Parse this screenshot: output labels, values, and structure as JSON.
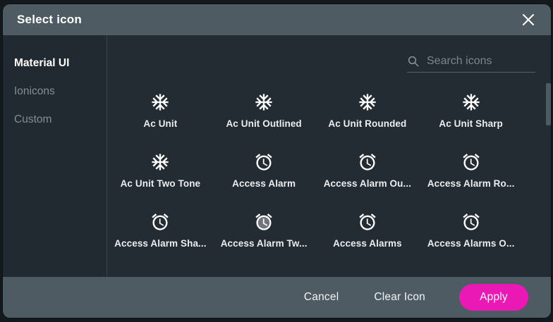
{
  "dialog": {
    "title": "Select icon"
  },
  "sidebar": {
    "items": [
      {
        "label": "Material UI",
        "active": true
      },
      {
        "label": "Ionicons",
        "active": false
      },
      {
        "label": "Custom",
        "active": false
      }
    ]
  },
  "search": {
    "placeholder": "Search icons",
    "icon": "magnifier"
  },
  "icon_grid": {
    "items": [
      {
        "label": "Ac Unit",
        "glyph": "ac-unit"
      },
      {
        "label": "Ac Unit Outlined",
        "glyph": "ac-unit"
      },
      {
        "label": "Ac Unit Rounded",
        "glyph": "ac-unit"
      },
      {
        "label": "Ac Unit Sharp",
        "glyph": "ac-unit"
      },
      {
        "label": "Ac Unit Two Tone",
        "glyph": "ac-unit"
      },
      {
        "label": "Access Alarm",
        "glyph": "access-alarm"
      },
      {
        "label": "Access Alarm Ou...",
        "glyph": "access-alarm"
      },
      {
        "label": "Access Alarm Ro...",
        "glyph": "access-alarm"
      },
      {
        "label": "Access Alarm Sha...",
        "glyph": "access-alarm"
      },
      {
        "label": "Access Alarm Tw...",
        "glyph": "access-alarm-two-tone"
      },
      {
        "label": "Access Alarms",
        "glyph": "access-alarm"
      },
      {
        "label": "Access Alarms O...",
        "glyph": "access-alarm"
      }
    ]
  },
  "footer": {
    "cancel_label": "Cancel",
    "clear_label": "Clear Icon",
    "apply_label": "Apply"
  },
  "colors": {
    "header_footer": "#4f5b63",
    "dialog_background": "#232c33",
    "sidebar_background": "#212a31",
    "accent_pink": "#ea18b4",
    "icon_white": "#ffffff",
    "muted_text": "#828d94"
  }
}
